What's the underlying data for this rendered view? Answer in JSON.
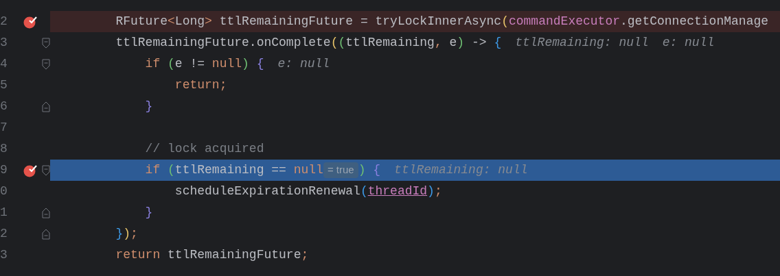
{
  "lines": [
    {
      "number": "2",
      "kind": "plain",
      "breakpoint": true,
      "current": false,
      "tokens": [
        {
          "kind": "plain",
          "text": "        RFuture"
        },
        {
          "kind": "keyword",
          "text": "<"
        },
        {
          "kind": "plain",
          "text": "Long"
        },
        {
          "kind": "keyword",
          "text": ">"
        },
        {
          "kind": "plain",
          "text": " ttlRemainingFuture = tryLockInnerAsync"
        },
        {
          "kind": "yellow",
          "text": "("
        },
        {
          "kind": "field",
          "text": "commandExecutor"
        },
        {
          "kind": "plain",
          "text": ".getConnectionManage"
        }
      ]
    },
    {
      "number": "3",
      "kind": "fold-start",
      "breakpoint": false,
      "current": false,
      "tokens": [
        {
          "kind": "plain",
          "text": "        ttlRemainingFuture.onComplete"
        },
        {
          "kind": "yellow",
          "text": "("
        },
        {
          "kind": "green",
          "text": "("
        },
        {
          "kind": "plain",
          "text": "ttlRemaining"
        },
        {
          "kind": "keyword",
          "text": ","
        },
        {
          "kind": "plain",
          "text": " e"
        },
        {
          "kind": "green",
          "text": ")"
        },
        {
          "kind": "plain",
          "text": " -> "
        },
        {
          "kind": "blue",
          "text": "{"
        },
        {
          "kind": "hint",
          "text": "ttlRemaining: null"
        },
        {
          "kind": "hint",
          "text": "e: null"
        }
      ]
    },
    {
      "number": "4",
      "kind": "fold-start",
      "breakpoint": false,
      "current": false,
      "tokens": [
        {
          "kind": "keyword",
          "text": "            if "
        },
        {
          "kind": "green",
          "text": "("
        },
        {
          "kind": "plain",
          "text": "e != "
        },
        {
          "kind": "keyword",
          "text": "null"
        },
        {
          "kind": "green",
          "text": ")"
        },
        {
          "kind": "violet",
          "text": " {"
        },
        {
          "kind": "hint",
          "text": "e: null"
        }
      ]
    },
    {
      "number": "5",
      "kind": "plain",
      "breakpoint": false,
      "current": false,
      "tokens": [
        {
          "kind": "keyword",
          "text": "                return;"
        }
      ]
    },
    {
      "number": "6",
      "kind": "fold-end",
      "breakpoint": false,
      "current": false,
      "tokens": [
        {
          "kind": "violet",
          "text": "            }"
        }
      ]
    },
    {
      "number": "7",
      "kind": "plain",
      "breakpoint": false,
      "current": false
    },
    {
      "number": "8",
      "kind": "plain",
      "breakpoint": false,
      "current": false,
      "tokens": [
        {
          "kind": "comment",
          "text": "            // lock acquired"
        }
      ]
    },
    {
      "number": "9",
      "kind": "fold-start",
      "breakpoint": true,
      "current": true,
      "tokens": [
        {
          "kind": "keyword",
          "text": "            if "
        },
        {
          "kind": "green",
          "text": "("
        },
        {
          "kind": "plain",
          "text": "ttlRemaining == "
        },
        {
          "kind": "keyword",
          "text": "null"
        },
        {
          "kind": "badge",
          "text": "= true"
        },
        {
          "kind": "green",
          "text": ")"
        },
        {
          "kind": "violet",
          "text": " {"
        },
        {
          "kind": "hint",
          "text": "ttlRemaining: null"
        }
      ]
    },
    {
      "number": "0",
      "kind": "plain",
      "breakpoint": false,
      "current": false,
      "tokens": [
        {
          "kind": "plain",
          "text": "                scheduleExpirationRenewal"
        },
        {
          "kind": "blue",
          "text": "("
        },
        {
          "kind": "link",
          "text": "threadId"
        },
        {
          "kind": "blue",
          "text": ")"
        },
        {
          "kind": "keyword",
          "text": ";"
        }
      ]
    },
    {
      "number": "1",
      "kind": "fold-end",
      "breakpoint": false,
      "current": false,
      "tokens": [
        {
          "kind": "violet",
          "text": "            }"
        }
      ]
    },
    {
      "number": "2",
      "kind": "fold-end",
      "breakpoint": false,
      "current": false,
      "tokens": [
        {
          "kind": "blue",
          "text": "        }"
        },
        {
          "kind": "yellow",
          "text": ")"
        },
        {
          "kind": "keyword",
          "text": ";"
        }
      ]
    },
    {
      "number": "3",
      "kind": "plain",
      "breakpoint": false,
      "current": false,
      "tokens": [
        {
          "kind": "keyword",
          "text": "        return"
        },
        {
          "kind": "plain",
          "text": " ttlRemainingFuture"
        },
        {
          "kind": "keyword",
          "text": ";"
        }
      ]
    }
  ]
}
